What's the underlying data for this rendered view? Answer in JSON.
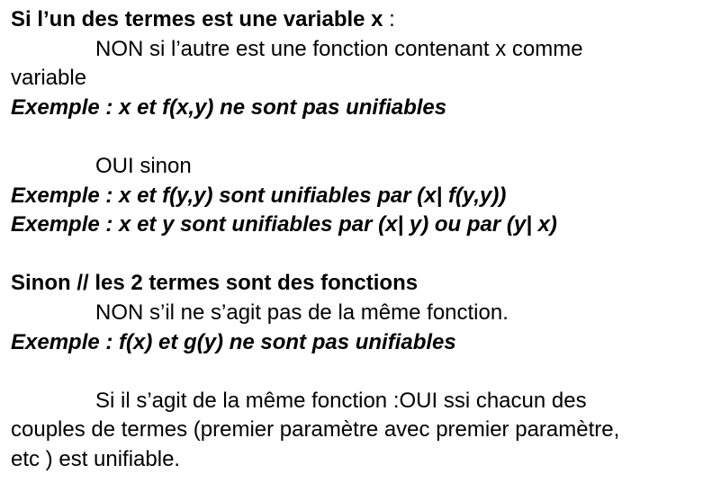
{
  "section1": {
    "heading": "Si l’un des termes est une variable x",
    "heading_suffix": " :",
    "no_rule_line1": "NON si l’autre est une fonction contenant x comme",
    "no_rule_line2": "variable",
    "example1": "Exemple : x et f(x,y) ne sont pas unifiables",
    "yes_rule": "OUI sinon",
    "example2": "Exemple : x et f(y,y) sont unifiables par (x| f(y,y))",
    "example3": "Exemple : x et y sont unifiables par (x| y) ou par (y| x)"
  },
  "section2": {
    "heading": "Sinon // les 2 termes sont des fonctions",
    "no_rule": "NON s’il ne s’agit pas de la même fonction.",
    "example4": "Exemple : f(x) et g(y) ne sont pas unifiables",
    "same_func_line1": "Si il s’agit de la même fonction :OUI ssi chacun des",
    "same_func_line2": "couples de termes (premier paramètre avec premier paramètre,",
    "same_func_line3": "etc ) est unifiable."
  }
}
